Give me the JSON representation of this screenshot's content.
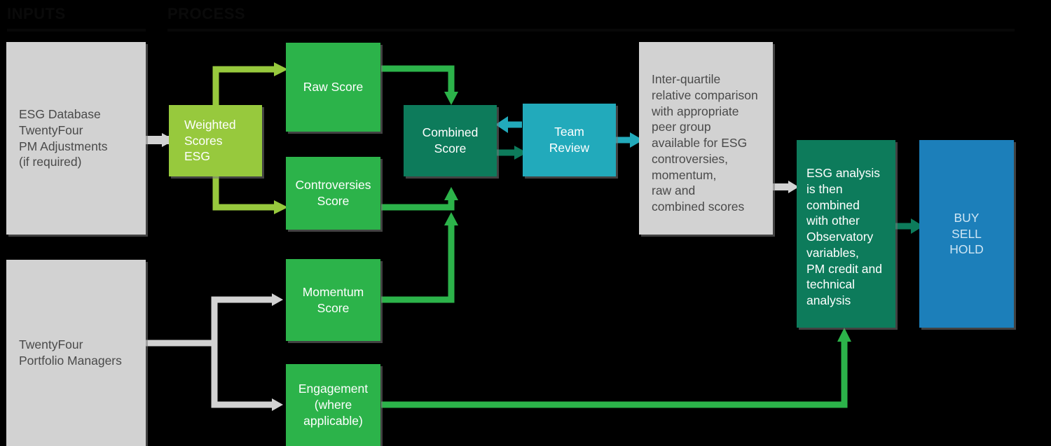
{
  "header": {
    "left_label": "INPUTS",
    "right_label": "PROCESS",
    "accent_grey": "#d2d2d2",
    "accent_light_green": "#97c93d",
    "accent_green": "#2cb34a",
    "accent_teal": "#0d7b5b",
    "accent_cyan": "#22aabb",
    "accent_blue": "#1c7fba"
  },
  "boxes": {
    "esg_database": "ESG Database\nTwentyFour\nPM Adjustments\n(if required)",
    "portfolio_managers": "TwentyFour\nPortfolio Managers",
    "weighted_scores": "Weighted\nScores\nESG",
    "raw_score": "Raw Score",
    "controversies_score": "Controversies\nScore",
    "momentum_score": "Momentum\nScore",
    "engagement": "Engagement\n(where\napplicable)",
    "combined_score": "Combined\nScore",
    "team_review": "Team\nReview",
    "interquartile": "Inter-quartile\nrelative comparison\nwith appropriate\npeer group\navailable for ESG\ncontroversies,\nmomentum,\nraw and\ncombined scores",
    "esg_analysis": "ESG analysis\nis then\ncombined\nwith other\nObservatory\nvariables,\nPM credit and\ntechnical\nanalysis",
    "decision": "BUY\nSELL\nHOLD"
  },
  "flow": {
    "edges": [
      {
        "name": "esg-database-to-weighted-scores",
        "color": "#d2d2d2"
      },
      {
        "name": "weighted-scores-to-raw-score",
        "color": "#97c93d"
      },
      {
        "name": "weighted-scores-to-controversies-score",
        "color": "#97c93d"
      },
      {
        "name": "raw-score-to-combined-score",
        "color": "#2cb34a"
      },
      {
        "name": "controversies-score-to-combined-score",
        "color": "#2cb34a"
      },
      {
        "name": "momentum-score-to-combined-score",
        "color": "#2cb34a"
      },
      {
        "name": "combined-score-to-team-review",
        "color": "#0d7b5b"
      },
      {
        "name": "team-review-to-combined-score",
        "color": "#22aabb"
      },
      {
        "name": "team-review-to-interquartile",
        "color": "#22aabb"
      },
      {
        "name": "interquartile-to-esg-analysis",
        "color": "#d2d2d2"
      },
      {
        "name": "portfolio-managers-to-momentum-score",
        "color": "#d2d2d2"
      },
      {
        "name": "portfolio-managers-to-engagement",
        "color": "#d2d2d2"
      },
      {
        "name": "engagement-to-esg-analysis",
        "color": "#2cb34a"
      },
      {
        "name": "esg-analysis-to-decision",
        "color": "#0d7b5b"
      }
    ]
  }
}
